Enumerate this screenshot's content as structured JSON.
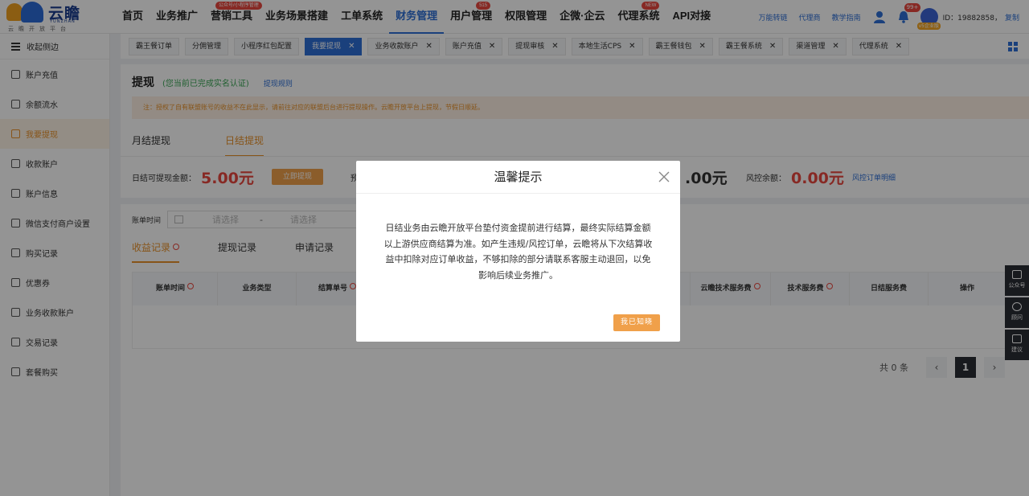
{
  "brand": {
    "name": "云瞻",
    "pinyin": "YUNZHAN",
    "tagline": "云瞻开放平台",
    "colors": {
      "blue": "#2e6fd6",
      "orange": "#e8912a",
      "red": "#e9483f"
    }
  },
  "nav": {
    "items": [
      {
        "label": "首页"
      },
      {
        "label": "业务推广"
      },
      {
        "label": "营销工具",
        "badge": "公众号/小程序管理"
      },
      {
        "label": "业务场景搭建"
      },
      {
        "label": "工单系统"
      },
      {
        "label": "财务管理",
        "active": true
      },
      {
        "label": "用户管理",
        "badge": "515"
      },
      {
        "label": "权限管理"
      },
      {
        "label": "企微·企云"
      },
      {
        "label": "代理系统",
        "badge": "NEW"
      },
      {
        "label": "API对接"
      }
    ],
    "right_links": [
      "万能转链",
      "代理商",
      "教学指南"
    ],
    "bell_badge": "99+",
    "vip": "v5企业版",
    "user_id": "ID：19882858，",
    "copy": "复制"
  },
  "sidebar": {
    "collapse": "收起侧边",
    "items": [
      "账户充值",
      "余额流水",
      "我要提现",
      "收款账户",
      "账户信息",
      "微信支付商户设置",
      "购买记录",
      "优惠券",
      "业务收款账户",
      "交易记录",
      "套餐购买"
    ],
    "active_index": 2
  },
  "tabs": [
    {
      "label": "霸王餐订单"
    },
    {
      "label": "分佣管理"
    },
    {
      "label": "小程序红包配置"
    },
    {
      "label": "我要提现",
      "active": true,
      "close": true
    },
    {
      "label": "业务收款账户",
      "close": true
    },
    {
      "label": "账户充值",
      "close": true
    },
    {
      "label": "提现审核",
      "close": true
    },
    {
      "label": "本地生活CPS",
      "close": true
    },
    {
      "label": "霸王餐钱包",
      "close": true
    },
    {
      "label": "霸王餐系统",
      "close": true
    },
    {
      "label": "渠道管理",
      "close": true
    },
    {
      "label": "代理系统",
      "close": true
    }
  ],
  "page": {
    "title": "提现",
    "note": "(您当前已完成实名认证)",
    "rule_link": "提现规则",
    "notice": "注：授权了自有联盟账号的收益不在此显示，请前往对应的联盟后台进行提现操作。云瞻开放平台上提现，节假日顺延。",
    "tabs": [
      "月结提现",
      "日结提现"
    ],
    "active_tab": 1,
    "withdrawable_label": "日结可提现金额：",
    "withdrawable_amount": "5.00元",
    "withdraw_button": "立即提现",
    "pre_label": "预",
    "partial_amount": ".00元",
    "risk_label": "风控余额：",
    "risk_amount": "0.00元",
    "risk_link": "风控订单明细",
    "filter_label": "账单时间",
    "date_placeholder": "请选择",
    "date_sep": "-",
    "record_tabs": [
      "收益记录",
      "提现记录",
      "申请记录"
    ],
    "columns": [
      "账单时间",
      "业务类型",
      "结算单号",
      "",
      "",
      "",
      "云瞻技术服务费",
      "技术服务费",
      "日结服务费",
      "操作"
    ],
    "total": "共 0 条",
    "current_page": "1",
    "prev": "‹",
    "next": "›"
  },
  "float": [
    {
      "label": "公众号"
    },
    {
      "label": "顾问"
    },
    {
      "label": "建议"
    }
  ],
  "modal": {
    "title": "温馨提示",
    "body": "日结业务由云瞻开放平台垫付资金提前进行结算，最终实际结算金额以上游供应商结算为准。如产生违规/风控订单，云瞻将从下次结算收益中扣除对应订单收益，不够扣除的部分请联系客服主动退回，以免影响后续业务推广。",
    "ok": "我已知晓"
  }
}
